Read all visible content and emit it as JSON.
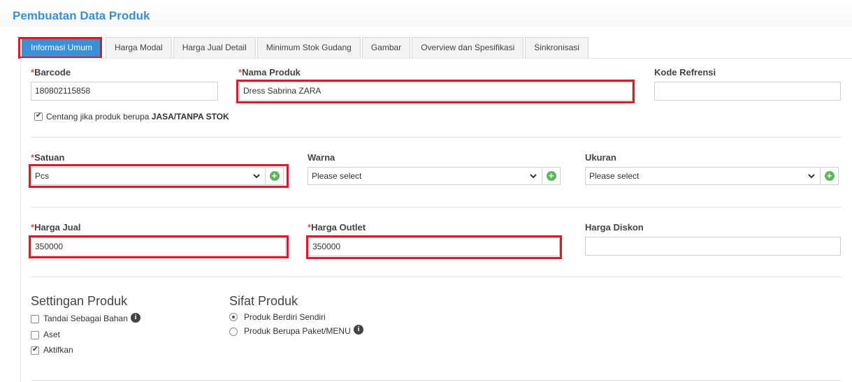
{
  "page": {
    "title": "Pembuatan Data Produk"
  },
  "tabs": [
    {
      "label": "Informasi Umum",
      "active": true
    },
    {
      "label": "Harga Modal"
    },
    {
      "label": "Harga Jual Detail"
    },
    {
      "label": "Minimum Stok Gudang"
    },
    {
      "label": "Gambar"
    },
    {
      "label": "Overview dan Spesifikasi"
    },
    {
      "label": "Sinkronisasi"
    }
  ],
  "required_mark": "*",
  "fields": {
    "barcode": {
      "label": "Barcode",
      "value": "180802115858",
      "required": true
    },
    "nama_produk": {
      "label": "Nama Produk",
      "value": "Dress Sabrina ZARA",
      "required": true
    },
    "kode_refrensi": {
      "label": "Kode Refrensi",
      "value": ""
    },
    "jasa_checkbox": {
      "prefix": "Centang jika produk berupa ",
      "strong": "JASA/TANPA STOK",
      "checked": true
    },
    "satuan": {
      "label": "Satuan",
      "value": "Pcs",
      "required": true
    },
    "warna": {
      "label": "Warna",
      "value": "Please select"
    },
    "ukuran": {
      "label": "Ukuran",
      "value": "Please select"
    },
    "harga_jual": {
      "label": "Harga Jual",
      "value": "350000",
      "required": true
    },
    "harga_outlet": {
      "label": "Harga Outlet",
      "value": "350000",
      "required": true
    },
    "harga_diskon": {
      "label": "Harga Diskon",
      "value": ""
    }
  },
  "settingan": {
    "title": "Settingan Produk",
    "items": [
      {
        "label": "Tandai Sebagai Bahan",
        "checked": false,
        "info": true
      },
      {
        "label": "Aset",
        "checked": false
      },
      {
        "label": "Aktifkan",
        "checked": true
      }
    ]
  },
  "sifat": {
    "title": "Sifat Produk",
    "options": [
      {
        "label": "Produk Berdiri Sendiri",
        "selected": true
      },
      {
        "label": "Produk Berupa Paket/MENU",
        "selected": false,
        "info": true
      }
    ]
  },
  "icons": {
    "add": "plus-circle-icon",
    "chevron": "chevron-down-icon",
    "info": "info-icon"
  },
  "colors": {
    "accent": "#3b8fd6",
    "highlight": "#e0192a",
    "add": "#5cb85c",
    "required": "#d9534f"
  }
}
